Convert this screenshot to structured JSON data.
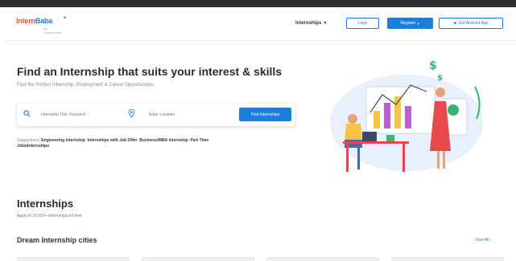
{
  "header": {
    "logo": {
      "part1": "Intern",
      "part2": "Baba",
      "tagline": "Be Experienced"
    },
    "nav_dropdown": "Internships",
    "login_label": "Login",
    "register_label": "Register",
    "app_label": "Get Android App"
  },
  "hero": {
    "title": "Find an Internship that suits your interest & skills",
    "subtitle": "Find the Perfect Internship, Employment & Career Opportunities.",
    "keyword_placeholder": "Internship Title, Keyword",
    "location_placeholder": "Enter Location",
    "find_button": "Find Internships",
    "suggestions_label": "Suggestions:",
    "suggestions": [
      "Engineering Internship",
      "Internships with Job Offer",
      "Business/MBA Internship",
      "Part Time",
      "Jobs/Internships"
    ]
  },
  "section": {
    "title": "Internships",
    "subtitle": "Apply to 10,000+ internships for free",
    "cities_title": "Dream Internship cities",
    "view_all": "View All"
  },
  "colors": {
    "primary": "#1b7fd8",
    "logo_orange": "#e0592a",
    "text_dark": "#2a2a2a"
  },
  "icons": [
    "search-icon",
    "location-pin-icon",
    "caret-down-icon"
  ]
}
